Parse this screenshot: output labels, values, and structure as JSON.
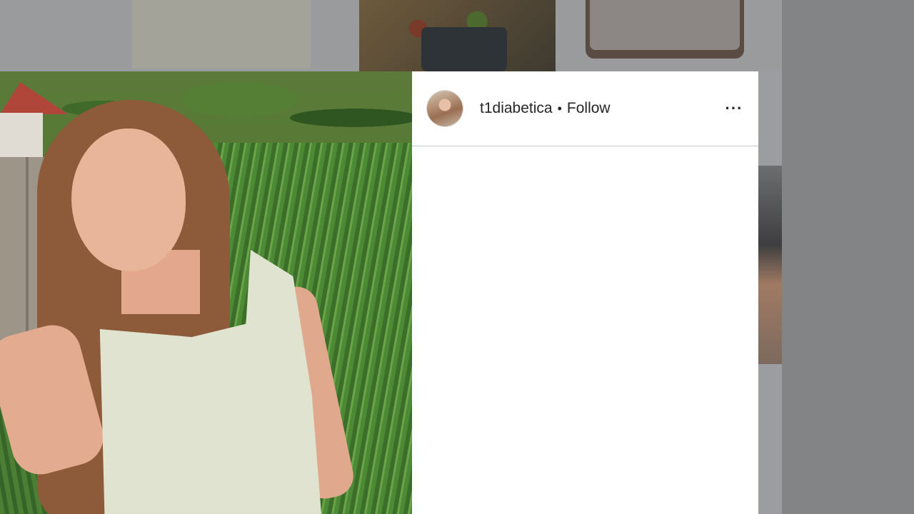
{
  "post": {
    "username": "t1diabetica",
    "separator": "•",
    "follow_label": "Follow",
    "more_icon": "more-options-icon",
    "more_glyph": "···"
  }
}
